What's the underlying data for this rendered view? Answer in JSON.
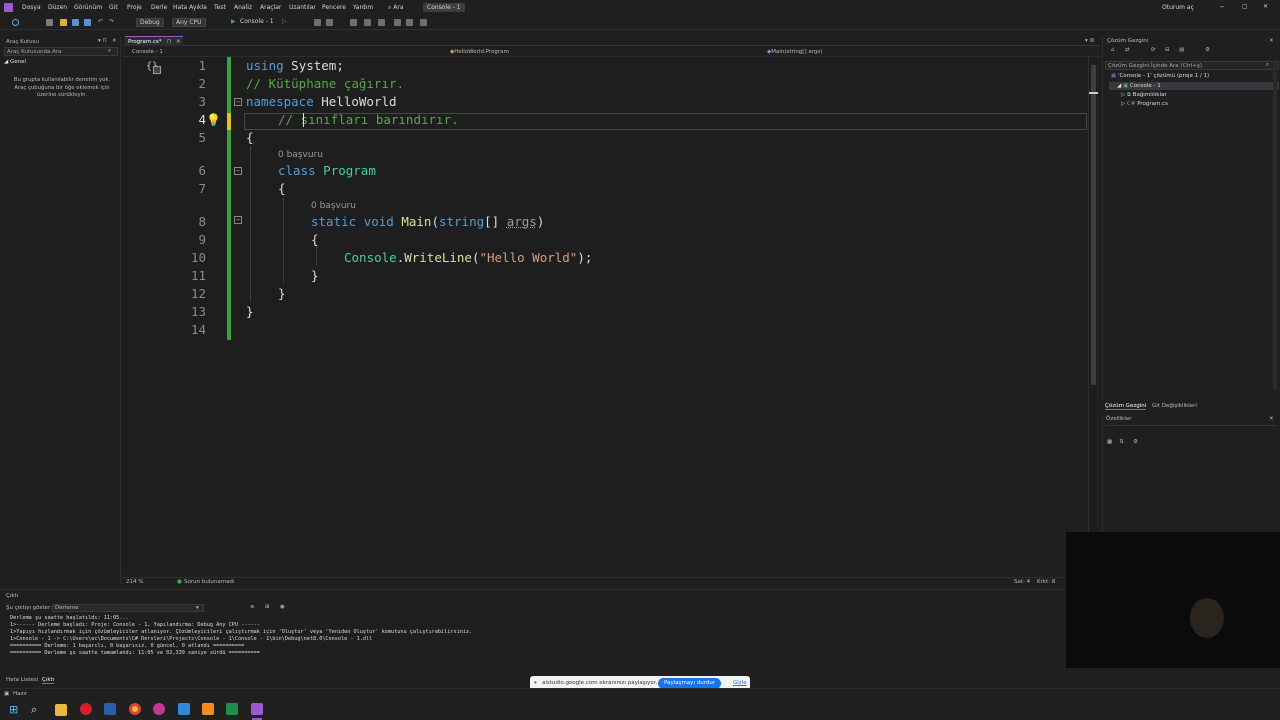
{
  "menu": {
    "items": [
      "Dosya",
      "Düzen",
      "Görünüm",
      "Git",
      "Proje",
      "Derle",
      "Hata Ayıkla",
      "Test",
      "Analiz",
      "Araçlar",
      "Uzantılar",
      "Pencere",
      "Yardım"
    ],
    "search_label": "Ara",
    "solution_badge": "Console - 1",
    "signin": "Oturum aç"
  },
  "toolbar": {
    "config": "Debug",
    "platform": "Any CPU",
    "run_label": "Console - 1"
  },
  "toolbox": {
    "title": "Araç Kutusu",
    "search_placeholder": "Araç Kutusunda Ara",
    "group": "Genel",
    "empty_msg": "Bu grupta kullanılabilir denetim yok. Araç çubuğuna bir öğe eklemek için üzerine sürükleyin."
  },
  "editor": {
    "tab": "Program.cs*",
    "project_dd": "Console - 1",
    "class_dd": "HelloWorld.Program",
    "member_dd": "Main(string[] args)",
    "line_numbers": [
      "1",
      "2",
      "3",
      "4",
      "5",
      "6",
      "7",
      "8",
      "9",
      "10",
      "11",
      "12",
      "13",
      "14"
    ],
    "refs": [
      "0 başvuru",
      "0 başvuru"
    ],
    "code": {
      "l1_kw": "using",
      "l1_rest": " System;",
      "l2": "// Kütüphane çağırır.",
      "l3_kw": "namespace",
      "l3_rest": " HelloWorld",
      "l4_a": "// ",
      "l4_b": "sınıfları barındırır.",
      "l5": "{",
      "l6_kw": "class",
      "l6_rest": " Program",
      "l7": "{",
      "l8_kw1": "static",
      "l8_kw2": "void",
      "l8_fn": "Main",
      "l8_p1": "(",
      "l8_kw3": "string",
      "l8_p2": "[] ",
      "l8_arg": "args",
      "l8_p3": ")",
      "l9": "{",
      "l10_ty": "Console",
      "l10_dot": ".",
      "l10_fn": "WriteLine",
      "l10_p1": "(",
      "l10_str": "\"Hello World\"",
      "l10_p2": ");",
      "l11": "}",
      "l12": "}",
      "l13": "}"
    },
    "zoom": "214 %",
    "issues": "Sorun bulunamadı",
    "line_status": "Sat: 4",
    "col_status": "Krkt: 8"
  },
  "solution_explorer": {
    "title": "Çözüm Gezgini",
    "search_placeholder": "Çözüm Gezgini İçinde Ara (Ctrl+ş)",
    "solution": "'Console - 1' çözümü (proje 1 / 1)",
    "project": "Console - 1",
    "deps": "Bağımlılıklar",
    "file": "Program.cs",
    "tabs": [
      "Çözüm Gezgini",
      "Git Değişiklikleri"
    ],
    "props_title": "Özellikler"
  },
  "output": {
    "title": "Çıktı",
    "show_label": "Şu çıktıyı göster:",
    "source": "Derleme",
    "lines": [
      "Derleme şu saatte başlatıldı: 11:05...",
      "1>------ Derleme başladı: Proje: Console - 1, Yapılandırma: Debug Any CPU ------",
      "1>Yapıyı hızlandırmak için çözümleyiciler atlanıyor. Çözümleyicileri çalıştırmak için 'Oluştur' veya 'Yeniden Oluştur' komutunu çalıştırabilirsiniz.",
      "1>Console - 1 -> C:\\Users\\ec\\Documents\\C# Dersleri\\Projects\\Console - 1\\Console - 1\\bin\\Debug\\net8.0\\Console - 1.dll",
      "========== Derleme: 1 başarılı, 0 başarısız, 0 güncel, 0 atlandı ==========",
      "========== Derleme şu saatte tamamlandı: 11:05 ve 02,339 saniye sürdü =========="
    ],
    "bottom_tabs": [
      "Hata Listesi",
      "Çıktı"
    ]
  },
  "share": {
    "text": "aistudio.google.com ekranınızı paylaşıyor.",
    "stop": "Paylaşmayı durdur",
    "hide": "Gizle"
  },
  "status": {
    "ready": "Hazır"
  },
  "colors": {
    "accent": "#9b59d0",
    "green_bar": "#3aa33a"
  }
}
